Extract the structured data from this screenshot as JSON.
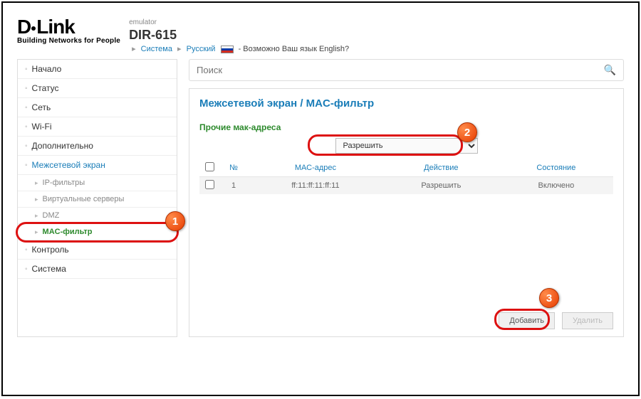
{
  "header": {
    "logo_text": "D-Link",
    "tagline": "Building Networks for People",
    "emulator": "emulator",
    "model": "DIR-615",
    "bc_system": "Система",
    "bc_lang": "Русский",
    "lang_prompt": "- Возможно Ваш язык English?"
  },
  "sidebar": {
    "items": [
      {
        "label": "Начало"
      },
      {
        "label": "Статус"
      },
      {
        "label": "Сеть"
      },
      {
        "label": "Wi-Fi"
      },
      {
        "label": "Дополнительно"
      },
      {
        "label": "Межсетевой экран",
        "active": true
      },
      {
        "label": "Контроль"
      },
      {
        "label": "Система"
      }
    ],
    "subitems": [
      {
        "label": "IP-фильтры"
      },
      {
        "label": "Виртуальные серверы"
      },
      {
        "label": "DMZ"
      },
      {
        "label": "MAC-фильтр",
        "highlight": true
      }
    ]
  },
  "search": {
    "placeholder": "Поиск"
  },
  "main": {
    "title": "Межсетевой экран /  MAC-фильтр",
    "section": "Прочие мак-адреса",
    "select_value": "Разрешить",
    "columns": {
      "num": "№",
      "mac": "МАС-адрес",
      "action": "Действие",
      "state": "Состояние"
    },
    "rows": [
      {
        "num": "1",
        "mac": "ff:11:ff:11:ff:11",
        "action": "Разрешить",
        "state": "Включено"
      }
    ],
    "buttons": {
      "add": "Добавить",
      "delete": "Удалить"
    }
  },
  "callouts": {
    "c1": "1",
    "c2": "2",
    "c3": "3"
  }
}
